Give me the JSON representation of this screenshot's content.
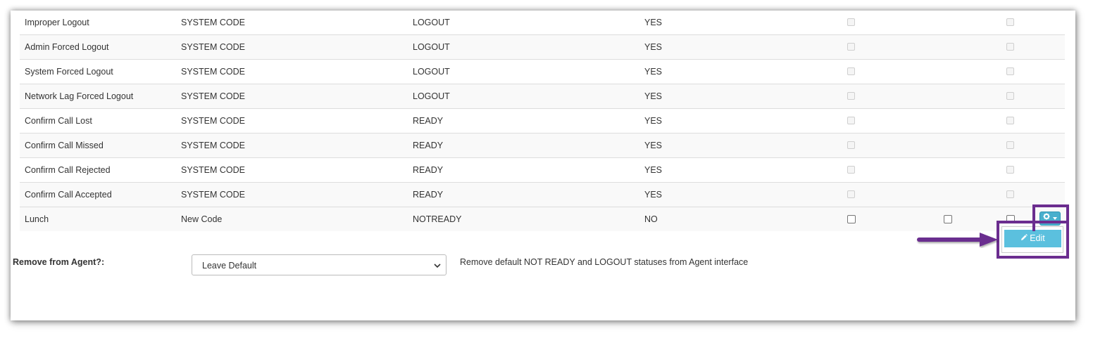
{
  "table": {
    "rows": [
      {
        "name": "Improper Logout",
        "category": "SYSTEM CODE",
        "status": "LOGOUT",
        "system": "YES"
      },
      {
        "name": "Admin Forced Logout",
        "category": "SYSTEM CODE",
        "status": "LOGOUT",
        "system": "YES"
      },
      {
        "name": "System Forced Logout",
        "category": "SYSTEM CODE",
        "status": "LOGOUT",
        "system": "YES"
      },
      {
        "name": "Network Lag Forced Logout",
        "category": "SYSTEM CODE",
        "status": "LOGOUT",
        "system": "YES"
      },
      {
        "name": "Confirm Call Lost",
        "category": "SYSTEM CODE",
        "status": "READY",
        "system": "YES"
      },
      {
        "name": "Confirm Call Missed",
        "category": "SYSTEM CODE",
        "status": "READY",
        "system": "YES"
      },
      {
        "name": "Confirm Call Rejected",
        "category": "SYSTEM CODE",
        "status": "READY",
        "system": "YES"
      },
      {
        "name": "Confirm Call Accepted",
        "category": "SYSTEM CODE",
        "status": "READY",
        "system": "YES"
      },
      {
        "name": "Lunch",
        "category": "New Code",
        "status": "NOTREADY",
        "system": "NO"
      }
    ]
  },
  "actions": {
    "gear_icon": "gear-icon",
    "caret_icon": "caret-down-icon",
    "edit_label": "Edit",
    "edit_icon": "pencil-icon",
    "button_color": "#49afcd",
    "highlight_color": "#6b2d8f"
  },
  "form": {
    "remove_label": "Remove from Agent?:",
    "remove_value": "Leave Default",
    "remove_help": "Remove default NOT READY and LOGOUT statuses from Agent interface"
  }
}
